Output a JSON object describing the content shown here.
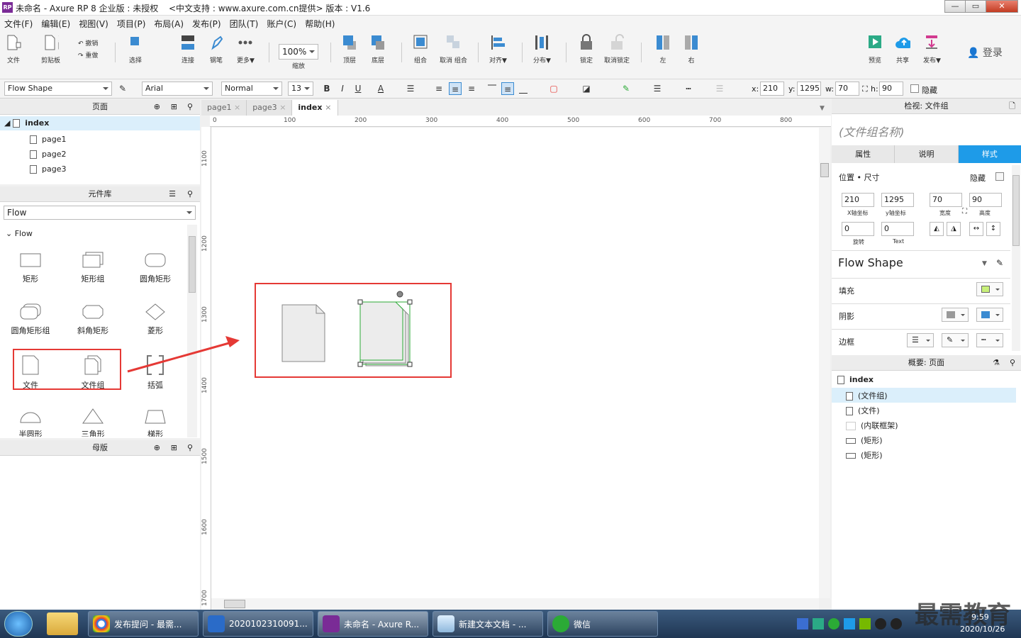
{
  "window": {
    "title": "未命名 - Axure RP 8 企业版 : 未授权",
    "subtitle": "<中文支持 : www.axure.com.cn提供> 版本 : V1.6",
    "logo": "RP"
  },
  "menu": [
    "文件(F)",
    "编辑(E)",
    "视图(V)",
    "项目(P)",
    "布局(A)",
    "发布(P)",
    "团队(T)",
    "账户(C)",
    "帮助(H)"
  ],
  "toolbar": {
    "file": "文件",
    "clipboard": "剪贴板",
    "undo": "撤销",
    "redo": "重做",
    "select": "选择",
    "connect": "连接",
    "pen": "钢笔",
    "more": "更多▼",
    "zoom_value": "100%",
    "zoom_label": "缩放",
    "top": "顶层",
    "bottom": "底层",
    "group": "组合",
    "ungroup": "取消 组合",
    "align": "对齐▼",
    "distribute": "分布▼",
    "lock": "锁定",
    "unlock": "取消锁定",
    "left": "左",
    "right": "右",
    "preview": "预览",
    "share": "共享",
    "publish": "发布▼",
    "login": "登录"
  },
  "format": {
    "style": "Flow Shape",
    "font": "Arial",
    "weight": "Normal",
    "size": "13",
    "x_label": "x:",
    "x": "210",
    "y_label": "y:",
    "y": "1295",
    "w_label": "w:",
    "w": "70",
    "h_label": "h:",
    "h": "90",
    "hide": "隐藏"
  },
  "pages": {
    "header": "页面",
    "root": "index",
    "children": [
      "page1",
      "page2",
      "page3"
    ]
  },
  "library": {
    "header": "元件库",
    "selected": "Flow",
    "group": "Flow",
    "items": [
      "矩形",
      "矩形组",
      "圆角矩形",
      "圆角矩形组",
      "斜角矩形",
      "菱形",
      "文件",
      "文件组",
      "括弧",
      "半圆形",
      "三角形",
      "梯形"
    ]
  },
  "masters": {
    "header": "母版"
  },
  "tabs": [
    "page1",
    "page3",
    "index"
  ],
  "ruler": {
    "h": [
      "0",
      "100",
      "200",
      "300",
      "400",
      "500",
      "600",
      "700",
      "800"
    ],
    "v": [
      "1100",
      "1200",
      "1300",
      "1400",
      "1500",
      "1600",
      "1700"
    ]
  },
  "inspector": {
    "header": "检视: 文件组",
    "name_placeholder": "(文件组名称)",
    "tabs": [
      "属性",
      "说明",
      "样式"
    ],
    "pos_title": "位置 • 尺寸",
    "hide": "隐藏",
    "x": "210",
    "y": "1295",
    "w": "70",
    "h": "90",
    "x_lbl": "X轴坐标",
    "y_lbl": "y轴坐标",
    "w_lbl": "宽度",
    "h_lbl": "高度",
    "rotate": "0",
    "text_rotate": "0",
    "rotate_lbl": "旋转",
    "text_lbl": "Text",
    "style_name": "Flow Shape",
    "fill": "填充",
    "shadow": "阴影",
    "border": "边框",
    "fill_color": "#c8f07a",
    "shadow_color": "#3b8bd1"
  },
  "outline": {
    "header": "概要: 页面",
    "root": "index",
    "items": [
      "(文件组)",
      "(文件)",
      "(内联框架)",
      "(矩形)",
      "(矩形)"
    ]
  },
  "taskbar": {
    "items": [
      "发布提问 - 最需...",
      "2020102310091...",
      "未命名 - Axure R...",
      "新建文本文档 - ...",
      "微信"
    ],
    "time": "9:59",
    "date": "2020/10/26",
    "watermark": "最需教育"
  },
  "colors": {
    "highlight": "#e53935",
    "accent": "#3b8bd1",
    "selection": "#dbeffb"
  }
}
